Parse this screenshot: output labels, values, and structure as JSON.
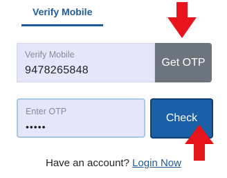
{
  "tab": {
    "label": "Verify Mobile"
  },
  "mobile": {
    "label": "Verify Mobile",
    "value": "9478265848"
  },
  "get_otp": {
    "label": "Get OTP"
  },
  "otp": {
    "label": "Enter OTP",
    "value": "•••••"
  },
  "check": {
    "label": "Check"
  },
  "annotations": {
    "arrow1": "1",
    "arrow2": "2",
    "color": "#e8141c"
  },
  "footer": {
    "text": "Have an account?",
    "link": "Login Now"
  },
  "colors": {
    "accent": "#1f5a98",
    "field_bg": "#e6e6fb",
    "otp_button": "#6c757d",
    "check_button": "#1b5fa6"
  }
}
